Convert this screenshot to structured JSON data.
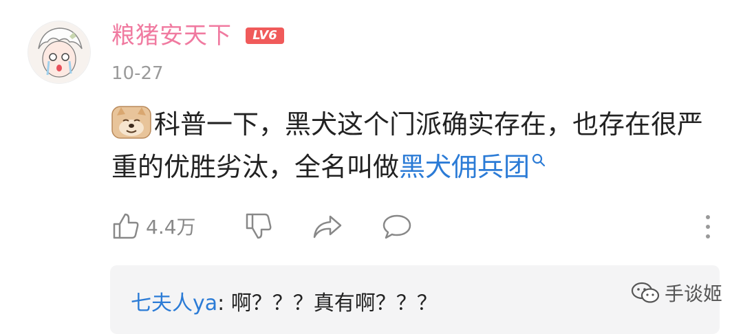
{
  "post": {
    "username": "粮猪安天下",
    "level": "LV6",
    "date": "10-27",
    "content_text": "科普一下，黑犬这个门派确实存在，也存在很严重的优胜劣汰，全名叫做",
    "link_text": "黑犬佣兵团",
    "emoji_icon": "shiba-dog-emoji-icon"
  },
  "actions": {
    "like_count": "4.4万"
  },
  "reply": {
    "user": "七夫人ya",
    "separator": ": ",
    "text": "啊？？？真有啊？？？"
  },
  "watermark": {
    "text": "手谈姬"
  },
  "colors": {
    "username": "#f07aa0",
    "level_badge": "#f05a5a",
    "link": "#2b7bd6",
    "secondary_text": "#9a9a9a",
    "reply_bg": "#f4f4f5"
  }
}
